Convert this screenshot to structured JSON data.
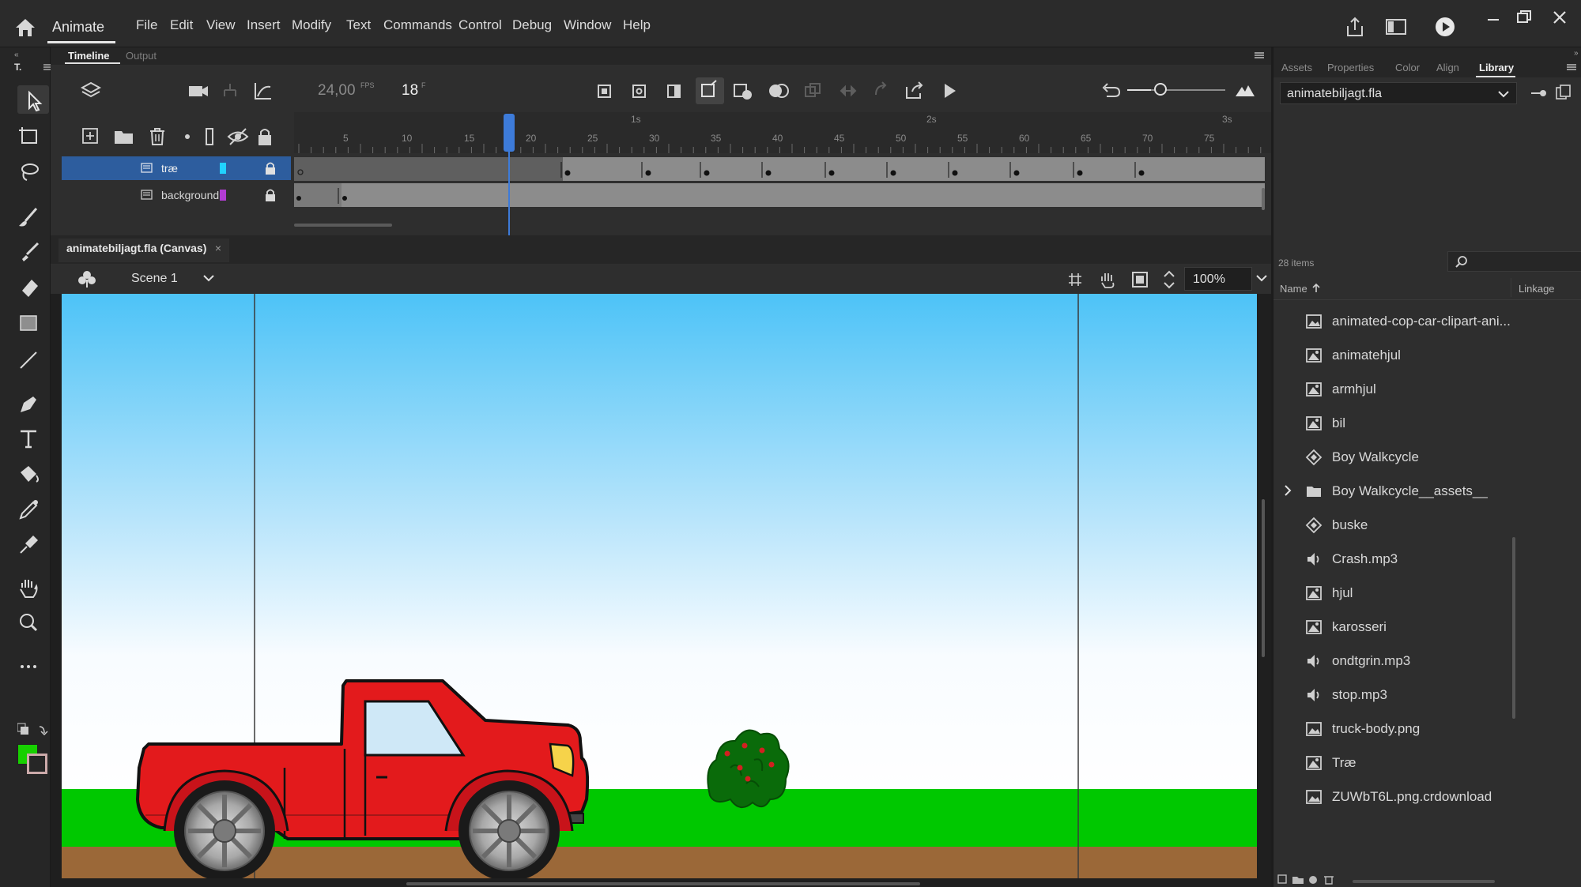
{
  "app": {
    "name": "Animate"
  },
  "menu": [
    "File",
    "Edit",
    "View",
    "Insert",
    "Modify",
    "Text",
    "Commands",
    "Control",
    "Debug",
    "Window",
    "Help"
  ],
  "timeline": {
    "tabs": [
      "Timeline",
      "Output"
    ],
    "fps": "24,00",
    "fps_unit": "FPS",
    "frame": "18",
    "frame_unit": "F",
    "layers": [
      {
        "name": "træ",
        "color": "#21d2ff",
        "selected": true
      },
      {
        "name": "background",
        "color": "#b23cd4",
        "selected": false
      }
    ],
    "ruler_frames": [
      "5",
      "10",
      "15",
      "20",
      "25",
      "30",
      "35",
      "40",
      "45",
      "50",
      "55",
      "60",
      "65",
      "70",
      "75"
    ],
    "ruler_seconds": [
      "1s",
      "2s",
      "3s"
    ],
    "playhead_frame": 18
  },
  "document": {
    "tab_title": "animatebiljagt.fla (Canvas)",
    "scene": "Scene 1",
    "zoom": "100%"
  },
  "stage": {
    "sky_top": "#4dc3f7",
    "sky_bottom": "#f8fcff",
    "grass": "#00c800",
    "dirt": "#9b6838",
    "truck_color": "#e31a1c"
  },
  "right_panel": {
    "tabs": [
      "Assets",
      "Properties",
      "Color",
      "Align",
      "Library"
    ],
    "active_tab": "Library",
    "document_select": "animatebiljagt.fla",
    "item_count": "28 items",
    "col_name": "Name",
    "col_linkage": "Linkage",
    "items": [
      {
        "name": "animated-cop-car-clipart-ani...",
        "icon": "bitmap-icon"
      },
      {
        "name": "animatehjul",
        "icon": "graphic-icon"
      },
      {
        "name": "armhjul",
        "icon": "graphic-icon"
      },
      {
        "name": "bil",
        "icon": "graphic-icon"
      },
      {
        "name": "Boy Walkcycle",
        "icon": "movieclip-icon"
      },
      {
        "name": "Boy Walkcycle__assets__",
        "icon": "folder-icon"
      },
      {
        "name": "buske",
        "icon": "movieclip-icon"
      },
      {
        "name": "Crash.mp3",
        "icon": "sound-icon"
      },
      {
        "name": "hjul",
        "icon": "graphic-icon"
      },
      {
        "name": "karosseri",
        "icon": "graphic-icon"
      },
      {
        "name": "ondtgrin.mp3",
        "icon": "sound-icon"
      },
      {
        "name": "stop.mp3",
        "icon": "sound-icon"
      },
      {
        "name": "truck-body.png",
        "icon": "bitmap-icon"
      },
      {
        "name": "Træ",
        "icon": "graphic-icon"
      },
      {
        "name": "ZUWbT6L.png.crdownload",
        "icon": "bitmap-icon"
      }
    ]
  }
}
